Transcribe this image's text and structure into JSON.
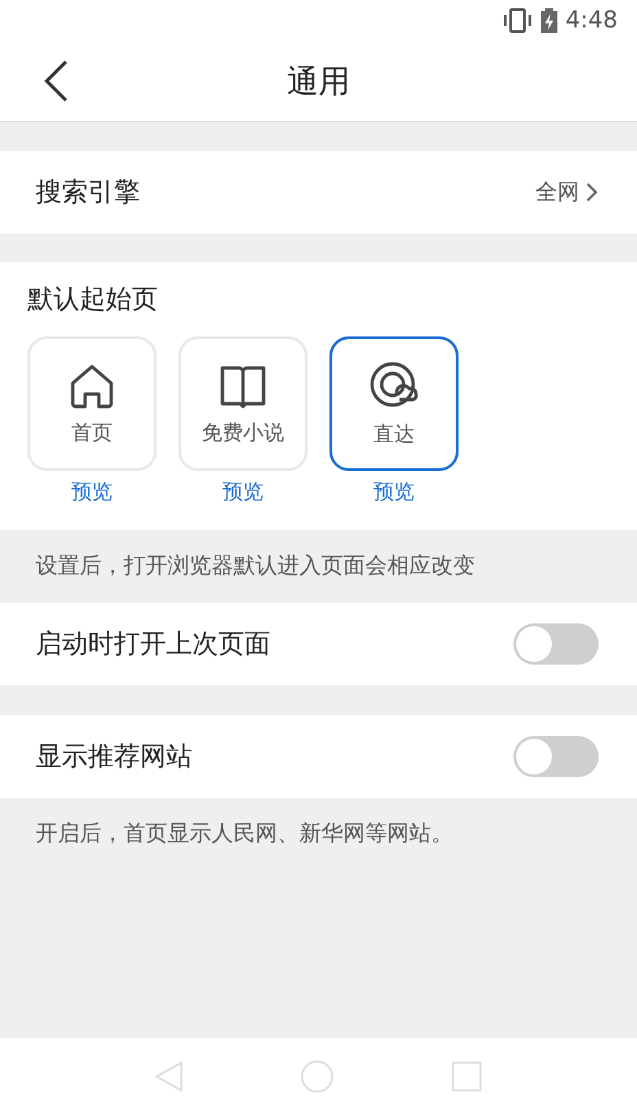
{
  "status_bar": {
    "time": "4:48"
  },
  "header": {
    "title": "通用"
  },
  "search_engine": {
    "label": "搜索引擎",
    "value": "全网"
  },
  "start_page": {
    "title": "默认起始页",
    "options": [
      {
        "kind": "home",
        "label": "首页",
        "preview": "预览",
        "selected": false
      },
      {
        "kind": "book",
        "label": "免费小说",
        "preview": "预览",
        "selected": false
      },
      {
        "kind": "direct",
        "label": "直达",
        "preview": "预览",
        "selected": true
      }
    ],
    "note": "设置后，打开浏览器默认进入页面会相应改变"
  },
  "toggles": [
    {
      "label": "启动时打开上次页面",
      "on": false
    },
    {
      "label": "显示推荐网站",
      "on": false,
      "note": "开启后，首页显示人民网、新华网等网站。"
    }
  ]
}
